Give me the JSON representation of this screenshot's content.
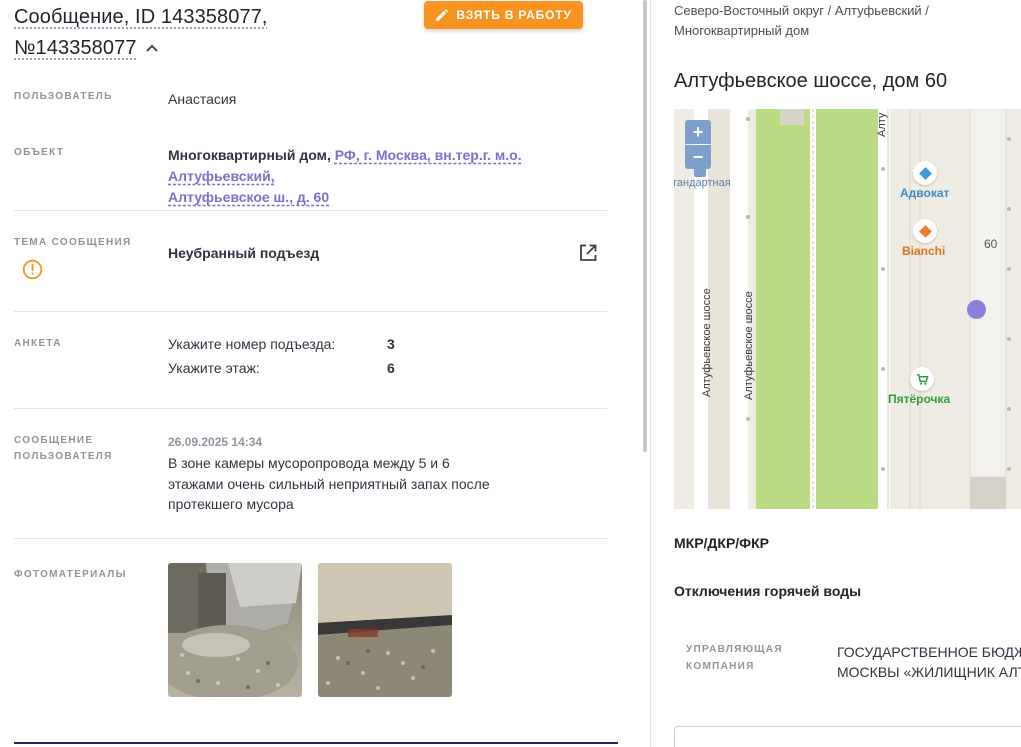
{
  "header": {
    "title_line1": "Сообщение, ID 143358077,",
    "title_line2": "№143358077",
    "take_button": "ВЗЯТЬ В РАБОТУ"
  },
  "fields": {
    "user_label": "ПОЛЬЗОВАТЕЛЬ",
    "user_value": "Анастасия",
    "object_label": "ОБЪЕКТ",
    "object_type": "Многоквартирный дом,",
    "object_address_line1": "РФ, г. Москва, вн.тер.г. м.о. Алтуфьевский,",
    "object_address_line2": "Алтуфьевское ш., д. 60",
    "topic_label": "ТЕМА СООБЩЕНИЯ",
    "topic_value": "Неубранный подъезд",
    "anketa_label": "АНКЕТА",
    "anketa": [
      {
        "question": "Укажите номер подъезда:",
        "answer": "3"
      },
      {
        "question": "Укажите этаж:",
        "answer": "6"
      }
    ],
    "message_label_line1": "СООБЩЕНИЕ",
    "message_label_line2": "ПОЛЬЗОВАТЕЛЯ",
    "message_date": "26.09.2025 14:34",
    "message_line1": "В зоне камеры мусоропровода между 5 и 6",
    "message_line2": "этажами очень сильный неприятный запах после",
    "message_line3": "протекшего мусора",
    "photos_label": "ФОТОМАТЕРИАЛЫ"
  },
  "right": {
    "breadcrumb_line1": "Северо-Восточный округ / Алтуфьевский /",
    "breadcrumb_line2": "Многоквартирный дом",
    "address_title": "Алтуфьевское шоссе, дом 60",
    "map": {
      "zoom_in": "+",
      "zoom_out": "−",
      "poi_standard": "тандартная",
      "street_label_a": "Алтуфьевское шоссе",
      "street_label_b": "Алтуфьевское шоссе",
      "street_label_top": "Алту",
      "poi_advokat": "Адвокат",
      "poi_bianchi": "Bianchi",
      "house_number": "60",
      "poi_pyaterochka": "Пятёрочка"
    },
    "section_mkr": "МКР/ДКР/ФКР",
    "section_hot_water": "Отключения горячей воды",
    "uk_label_line1": "УПРАВЛЯЮЩАЯ",
    "uk_label_line2": "КОМПАНИЯ",
    "uk_value_line1": "ГОСУДАРСТВЕННОЕ БЮДЖЕ",
    "uk_value_line2": "МОСКВЫ «ЖИЛИЩНИК АЛТУ"
  },
  "colors": {
    "accent_orange": "#f7931e",
    "link_purple": "#7c6fcf",
    "warning_orange": "#f7931e",
    "map_marker": "#8a7fdc"
  }
}
